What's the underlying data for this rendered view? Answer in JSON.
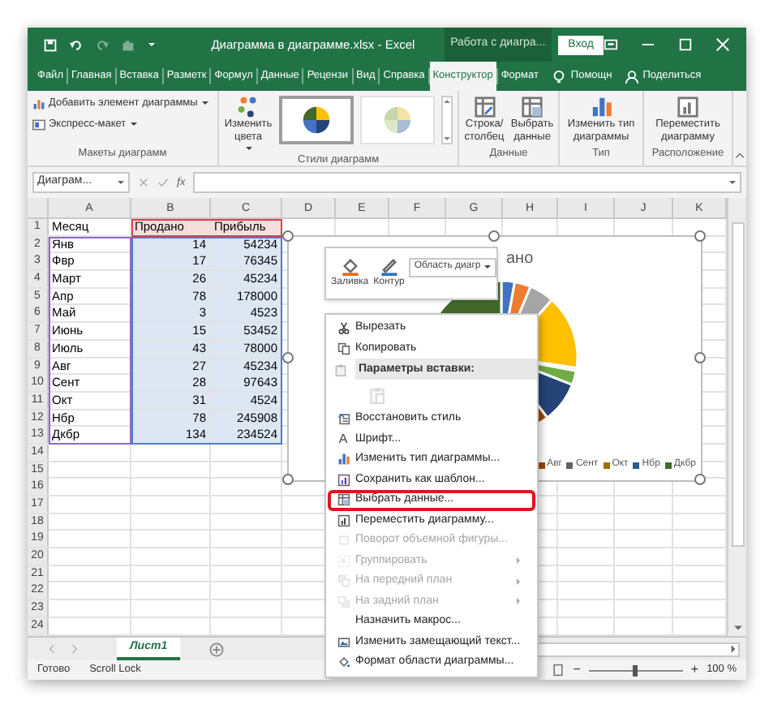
{
  "window": {
    "title": "Диаграмма в диаграмме.xlsx  -  Excel",
    "context_title": "Работа с диагра...",
    "sign_in": "Вход"
  },
  "ribbon_tabs": [
    {
      "label": "Файл",
      "selected": false
    },
    {
      "label": "Главная",
      "selected": false
    },
    {
      "label": "Вставка",
      "selected": false
    },
    {
      "label": "Разметк",
      "selected": false
    },
    {
      "label": "Формул",
      "selected": false
    },
    {
      "label": "Данные",
      "selected": false
    },
    {
      "label": "Рецензи",
      "selected": false
    },
    {
      "label": "Вид",
      "selected": false
    },
    {
      "label": "Справка",
      "selected": false
    },
    {
      "label": "Конструктор",
      "selected": true
    },
    {
      "label": "Формат",
      "selected": false
    }
  ],
  "tell_me": "Помощн",
  "share": "Поделиться",
  "ribbon": {
    "layouts": {
      "label": "Макеты диаграмм",
      "add_element": "Добавить элемент диаграммы",
      "quick_layout": "Экспресс-макет"
    },
    "styles": {
      "label": "Стили диаграмм",
      "change_colors": "Изменить цвета",
      "thumbnails": [
        {
          "selected": true
        },
        {
          "selected": false
        }
      ]
    },
    "data": {
      "label": "Данные",
      "buttons": [
        "Строка/ столбец",
        "Выбрать данные"
      ]
    },
    "type": {
      "label": "Тип",
      "button": "Изменить тип диаграммы"
    },
    "location": {
      "label": "Расположение",
      "button": "Переместить диаграмму"
    }
  },
  "formula_bar": {
    "name_box": "Диаграм...",
    "function_label": "fx"
  },
  "sheet": {
    "columns": [
      "A",
      "B",
      "C",
      "D",
      "E",
      "F",
      "G",
      "H",
      "I",
      "J",
      "K"
    ],
    "range_outlines": [
      {
        "kind": "categories",
        "color": "#8e6cc0"
      },
      {
        "kind": "values",
        "color": "#4f7fc9"
      },
      {
        "kind": "series_name",
        "color": "#d9424a"
      }
    ],
    "rows": [
      {
        "number": "1",
        "cells": [
          "Месяц",
          "Продано",
          "Прибыль"
        ]
      },
      {
        "number": "2",
        "cells": [
          "Янв",
          "14",
          "54234"
        ]
      },
      {
        "number": "3",
        "cells": [
          "Фвр",
          "17",
          "76345"
        ]
      },
      {
        "number": "4",
        "cells": [
          "Март",
          "26",
          "45234"
        ]
      },
      {
        "number": "5",
        "cells": [
          "Апр",
          "78",
          "178000"
        ]
      },
      {
        "number": "6",
        "cells": [
          "Май",
          "3",
          "4523"
        ]
      },
      {
        "number": "7",
        "cells": [
          "Июнь",
          "15",
          "53452"
        ]
      },
      {
        "number": "8",
        "cells": [
          "Июль",
          "43",
          "78000"
        ]
      },
      {
        "number": "9",
        "cells": [
          "Авг",
          "27",
          "45234"
        ]
      },
      {
        "number": "10",
        "cells": [
          "Сент",
          "28",
          "97643"
        ]
      },
      {
        "number": "11",
        "cells": [
          "Окт",
          "31",
          "4524"
        ]
      },
      {
        "number": "12",
        "cells": [
          "Нбр",
          "78",
          "245908"
        ]
      },
      {
        "number": "13",
        "cells": [
          "Дкбр",
          "134",
          "234524"
        ]
      },
      {
        "number": "14"
      },
      {
        "number": "15"
      },
      {
        "number": "16"
      },
      {
        "number": "17"
      },
      {
        "number": "18"
      },
      {
        "number": "19"
      },
      {
        "number": "20"
      },
      {
        "number": "21"
      },
      {
        "number": "22"
      },
      {
        "number": "23"
      },
      {
        "number": "24"
      }
    ]
  },
  "chart": {
    "title": "ано",
    "legend": [
      {
        "label": "Авг",
        "color": "#9e480e"
      },
      {
        "label": "Сент",
        "color": "#636363"
      },
      {
        "label": "Окт",
        "color": "#997300"
      },
      {
        "label": "Нбр",
        "color": "#255e91"
      },
      {
        "label": "Дкбр",
        "color": "#43682b"
      }
    ]
  },
  "mini_toolbar": {
    "fill": "Заливка",
    "outline": "Контур",
    "element": "Область диагр"
  },
  "context_menu": [
    {
      "kind": "item",
      "label": "Вырезать",
      "disabled": false,
      "submenu": false,
      "highlighted": false
    },
    {
      "kind": "item",
      "label": "Копировать",
      "disabled": false,
      "submenu": false,
      "highlighted": false
    },
    {
      "kind": "header",
      "label": "Параметры вставки:"
    },
    {
      "kind": "paste-option",
      "disabled": true
    },
    {
      "kind": "item",
      "label": "Восстановить стиль",
      "disabled": false,
      "submenu": false,
      "highlighted": false
    },
    {
      "kind": "item",
      "label": "Шрифт...",
      "glyph": "A",
      "disabled": false,
      "submenu": false,
      "highlighted": false
    },
    {
      "kind": "item",
      "label": "Изменить тип диаграммы...",
      "disabled": false,
      "submenu": false,
      "highlighted": false
    },
    {
      "kind": "item",
      "label": "Сохранить как шаблон...",
      "disabled": false,
      "submenu": false,
      "highlighted": false
    },
    {
      "kind": "item",
      "label": "Выбрать данные...",
      "disabled": false,
      "submenu": false,
      "highlighted": true
    },
    {
      "kind": "item",
      "label": "Переместить диаграмму...",
      "disabled": false,
      "submenu": false,
      "highlighted": false
    },
    {
      "kind": "item",
      "label": "Поворот объемной фигуры...",
      "disabled": true,
      "submenu": false,
      "highlighted": false
    },
    {
      "kind": "item",
      "label": "Группировать",
      "disabled": true,
      "submenu": true,
      "highlighted": false
    },
    {
      "kind": "item",
      "label": "На передний план",
      "disabled": true,
      "submenu": true,
      "highlighted": false
    },
    {
      "kind": "item",
      "label": "На задний план",
      "disabled": true,
      "submenu": true,
      "highlighted": false
    },
    {
      "kind": "item",
      "label": "Назначить макрос...",
      "disabled": false,
      "submenu": false,
      "highlighted": false
    },
    {
      "kind": "item",
      "label": "Изменить замещающий текст...",
      "disabled": false,
      "submenu": false,
      "highlighted": false
    },
    {
      "kind": "item",
      "label": "Формат области диаграммы...",
      "disabled": false,
      "submenu": false,
      "highlighted": false
    }
  ],
  "sheet_tabs": [
    {
      "label": "Лист1",
      "selected": true
    }
  ],
  "status_bar": {
    "ready": "Готово",
    "scroll_lock": "Scroll Lock",
    "zoom": {
      "minus": "−",
      "plus": "+",
      "level": 0.5,
      "reading": "100 %"
    }
  }
}
